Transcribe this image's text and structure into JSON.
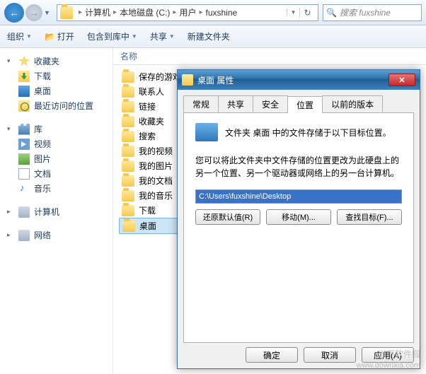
{
  "nav": {
    "path": [
      "计算机",
      "本地磁盘 (C:)",
      "用户",
      "fuxshine"
    ],
    "search_placeholder": "搜索 fuxshine"
  },
  "toolbar": {
    "organize": "组织",
    "open": "打开",
    "include": "包含到库中",
    "share": "共享",
    "newfolder": "新建文件夹"
  },
  "sidebar": {
    "favorites": {
      "label": "收藏夹",
      "items": [
        "下载",
        "桌面",
        "最近访问的位置"
      ]
    },
    "libraries": {
      "label": "库",
      "items": [
        "视频",
        "图片",
        "文档",
        "音乐"
      ]
    },
    "computer": "计算机",
    "network": "网络"
  },
  "content": {
    "col_name": "名称",
    "rows": [
      "保存的游戏",
      "联系人",
      "链接",
      "收藏夹",
      "搜索",
      "我的视频",
      "我的图片",
      "我的文档",
      "我的音乐",
      "下载",
      "桌面"
    ]
  },
  "dialog": {
    "title": "桌面 属性",
    "tabs": [
      "常规",
      "共享",
      "安全",
      "位置",
      "以前的版本"
    ],
    "active_tab": 3,
    "loc_topline": "文件夹 桌面 中的文件存储于以下目标位置。",
    "loc_msg": "您可以将此文件夹中文件存储的位置更改为此硬盘上的另一个位置、另一个驱动器或网络上的另一台计算机。",
    "path_value": "C:\\Users\\fuxshine\\Desktop",
    "btn_restore": "还原默认值(R)",
    "btn_move": "移动(M)...",
    "btn_find": "查找目标(F)...",
    "btn_ok": "确定",
    "btn_cancel": "取消",
    "btn_apply": "应用(A)"
  },
  "watermark": {
    "line1": "当下软件园",
    "line2": "www.downxia.com"
  }
}
